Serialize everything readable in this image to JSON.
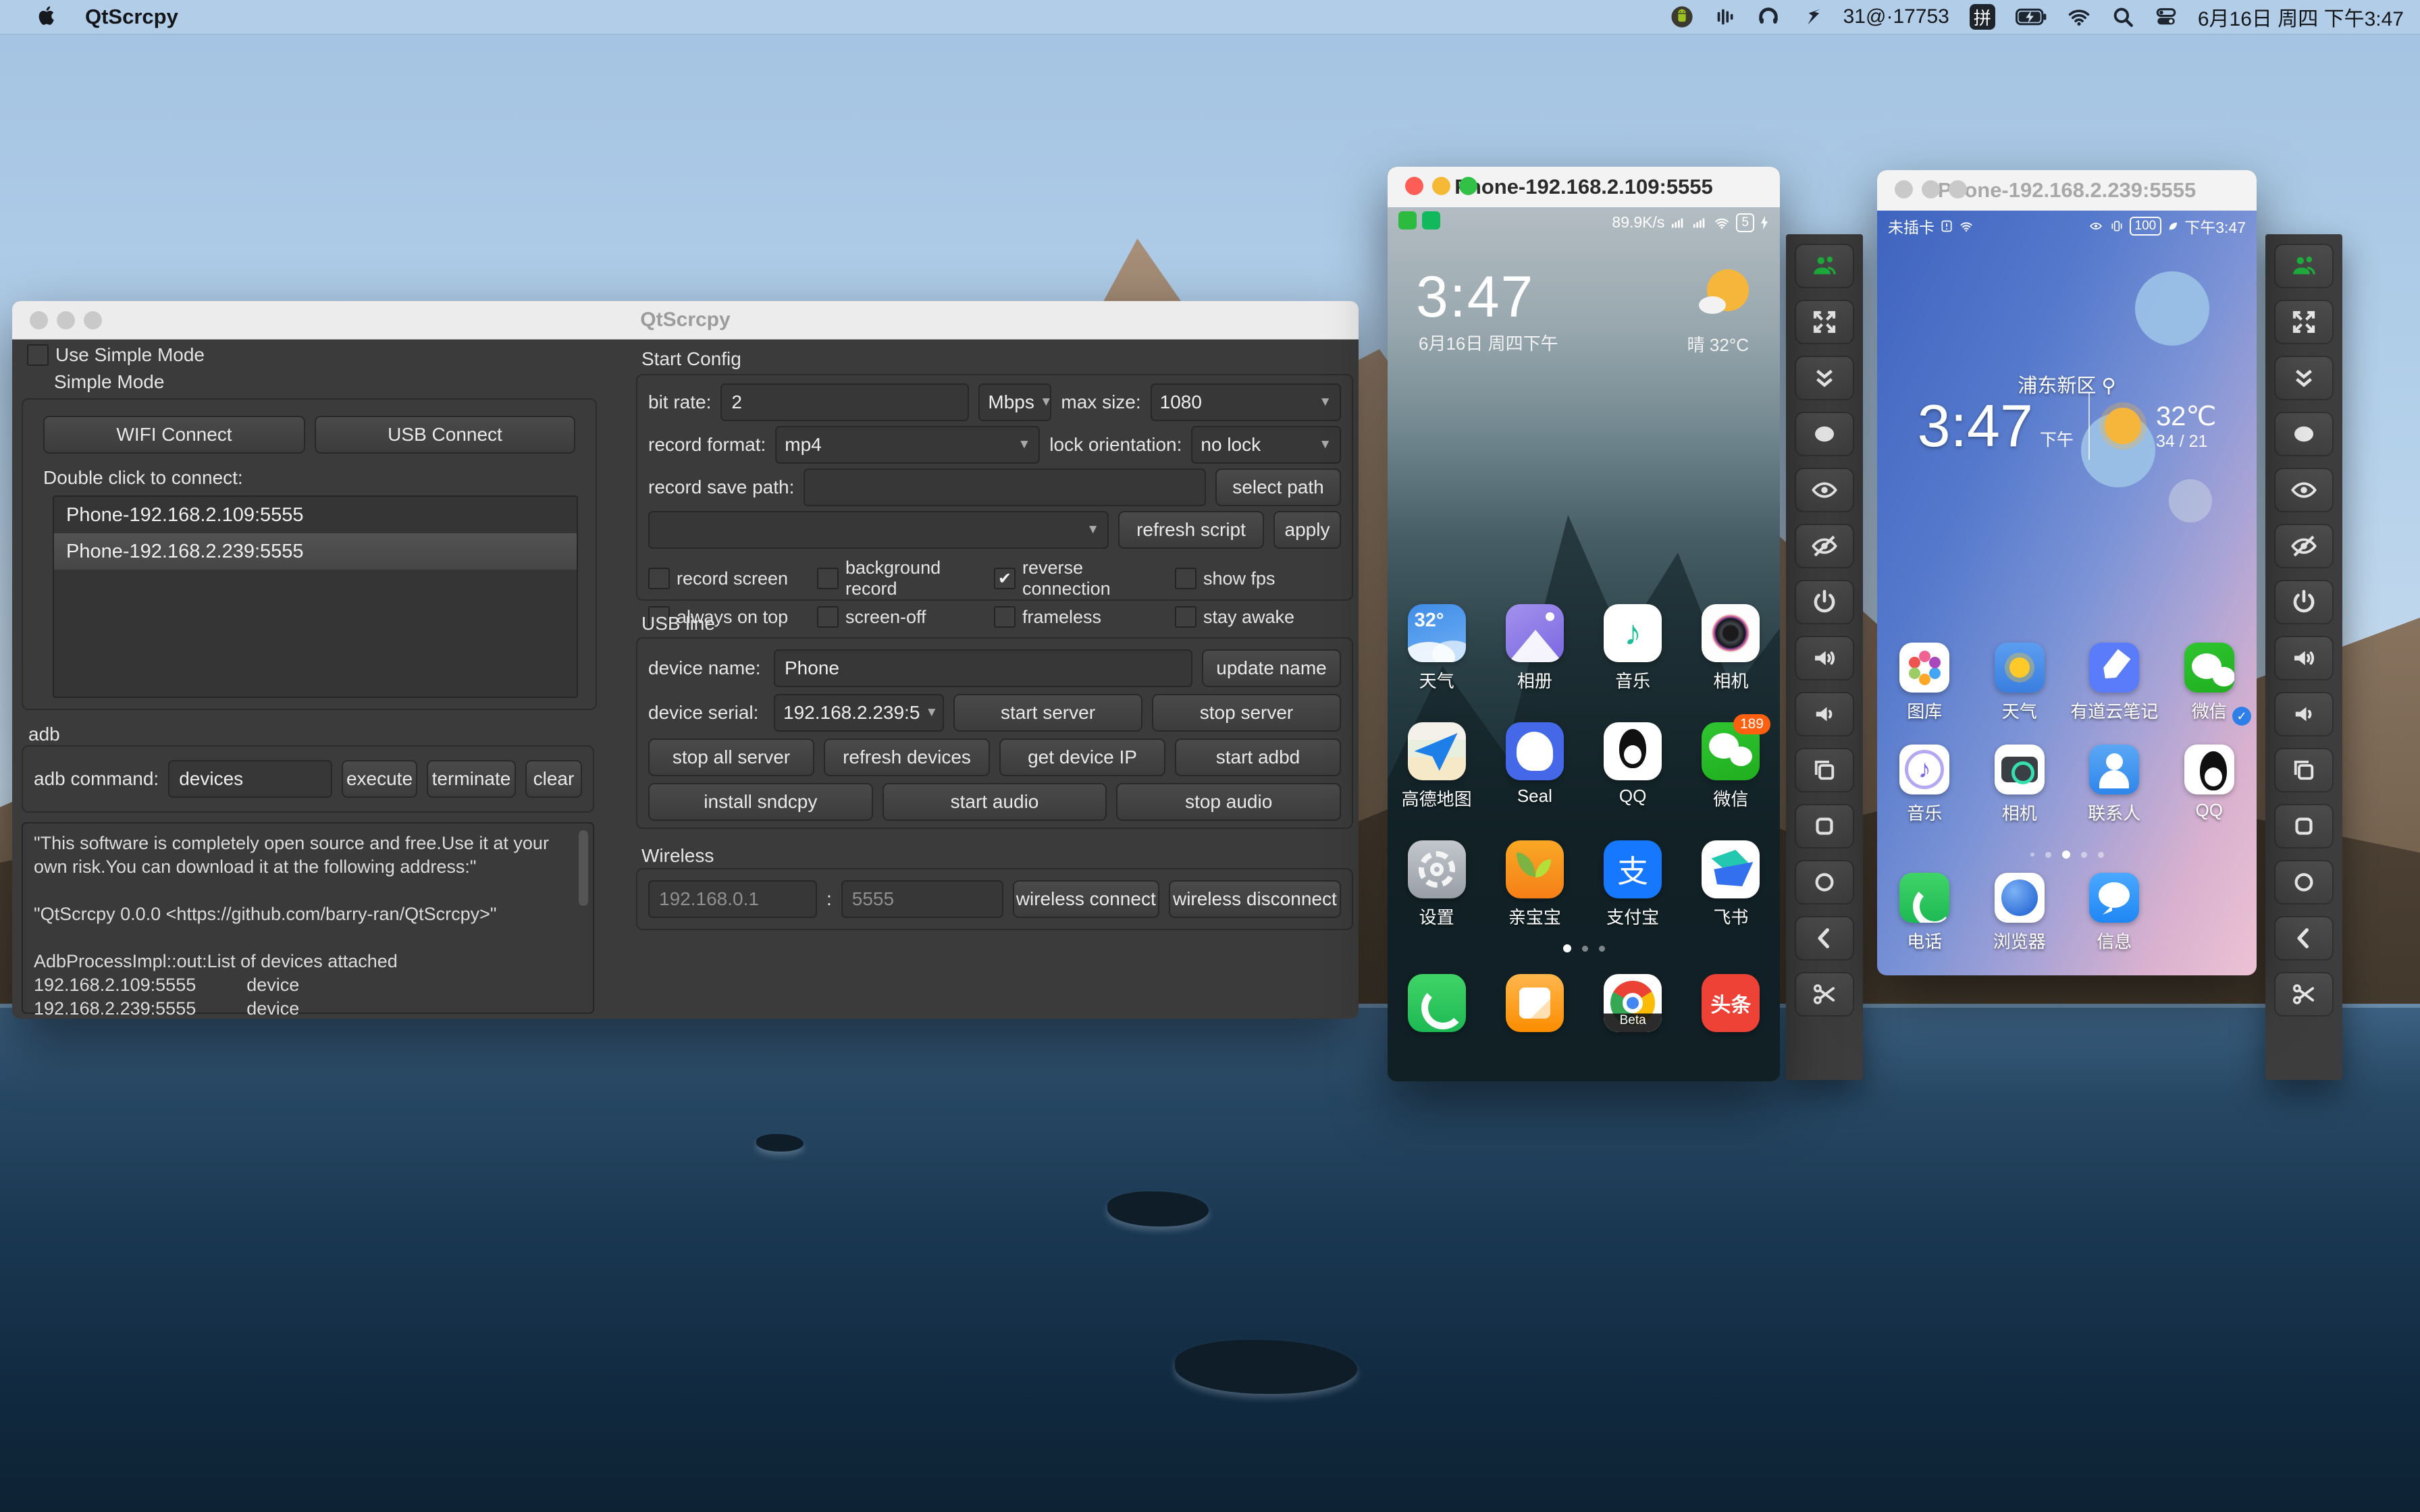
{
  "menu_bar": {
    "app_name": "QtScrcpy",
    "status_count": "31@·17753",
    "ime": "拼",
    "datetime": "6月16日 周四 下午3:47"
  },
  "main_window": {
    "title": "QtScrcpy",
    "use_simple_mode": "Use Simple Mode",
    "simple_mode": "Simple Mode",
    "wifi_connect": "WIFI Connect",
    "usb_connect": "USB Connect",
    "double_click_hint": "Double click to connect:",
    "device_list": [
      "Phone-192.168.2.109:5555",
      "Phone-192.168.2.239:5555"
    ],
    "adb_label": "adb",
    "adb_command_label": "adb command:",
    "adb_command_value": "devices",
    "execute": "execute",
    "terminate": "terminate",
    "clear": "clear",
    "log": [
      "\"This software is completely open source and free.Use it at your own risk.You can download it at the following address:\"",
      "",
      "\"QtScrcpy 0.0.0 <https://github.com/barry-ran/QtScrcpy>\"",
      "",
      "AdbProcessImpl::out:List of devices attached",
      "192.168.2.109:5555          device",
      "192.168.2.239:5555          device"
    ],
    "start_config": {
      "label": "Start Config",
      "bit_rate_label": "bit rate:",
      "bit_rate_value": "2",
      "bit_rate_unit": "Mbps",
      "max_size_label": "max size:",
      "max_size_value": "1080",
      "record_format_label": "record format:",
      "record_format_value": "mp4",
      "lock_orientation_label": "lock orientation:",
      "lock_orientation_value": "no lock",
      "record_save_path_label": "record save path:",
      "record_save_path_value": "",
      "select_path": "select path",
      "refresh_script": "refresh script",
      "apply": "apply",
      "checks": [
        {
          "label": "record screen",
          "checked": false
        },
        {
          "label": "background record",
          "checked": false
        },
        {
          "label": "reverse connection",
          "checked": true
        },
        {
          "label": "show fps",
          "checked": false
        },
        {
          "label": "always on top",
          "checked": false
        },
        {
          "label": "screen-off",
          "checked": false
        },
        {
          "label": "frameless",
          "checked": false
        },
        {
          "label": "stay awake",
          "checked": false
        }
      ]
    },
    "usb_line": {
      "label": "USB line",
      "device_name_label": "device name:",
      "device_name_value": "Phone",
      "update_name": "update name",
      "device_serial_label": "device serial:",
      "device_serial_value": "192.168.2.239:5",
      "start_server": "start server",
      "stop_server": "stop server",
      "stop_all_server": "stop all server",
      "refresh_devices": "refresh devices",
      "get_device_ip": "get device IP",
      "start_adbd": "start adbd",
      "install_sndcpy": "install sndcpy",
      "start_audio": "start audio",
      "stop_audio": "stop audio"
    },
    "wireless": {
      "label": "Wireless",
      "ip_placeholder": "192.168.0.1",
      "colon": ":",
      "port_placeholder": "5555",
      "connect": "wireless connect",
      "disconnect": "wireless disconnect"
    }
  },
  "phone1": {
    "title": "Phone-192.168.2.109:5555",
    "net_speed": "89.9K/s",
    "battery": "5",
    "clock": "3:47",
    "date": "6月16日 周四下午",
    "weather": "晴  32°C",
    "apps": [
      {
        "label": "天气",
        "glyph": "32°"
      },
      {
        "label": "相册"
      },
      {
        "label": "音乐",
        "glyph": "♪"
      },
      {
        "label": "相机"
      },
      {
        "label": "高德地图"
      },
      {
        "label": "Seal"
      },
      {
        "label": "QQ"
      },
      {
        "label": "微信",
        "badge": "189"
      },
      {
        "label": "设置"
      },
      {
        "label": "亲宝宝"
      },
      {
        "label": "支付宝",
        "glyph": "支"
      },
      {
        "label": "飞书"
      }
    ],
    "dock_chrome_label": "Beta",
    "dock_toutiao_glyph": "头条"
  },
  "phone2": {
    "title": "Phone-192.168.2.239:5555",
    "status_left": "未插卡",
    "battery": "100",
    "status_time": "下午3:47",
    "district": "浦东新区",
    "clock": "3:47",
    "ampm": "下午",
    "temp": "32℃",
    "hilo": "34 / 21",
    "apps": [
      {
        "label": "图库"
      },
      {
        "label": "天气"
      },
      {
        "label": "有道云笔记"
      },
      {
        "label": "微信",
        "check": "✓"
      },
      {
        "label": "音乐",
        "glyph": "♪"
      },
      {
        "label": "相机"
      },
      {
        "label": "联系人"
      },
      {
        "label": "QQ"
      },
      {
        "label": "电话"
      },
      {
        "label": "浏览器"
      },
      {
        "label": "信息"
      }
    ]
  }
}
